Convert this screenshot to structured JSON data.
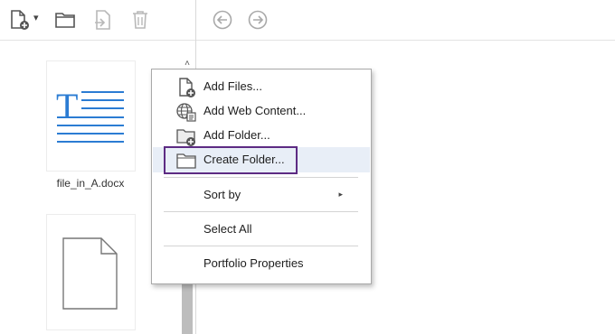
{
  "toolbar": {
    "icons": [
      "new-file-icon",
      "folder-icon",
      "extract-icon",
      "trash-icon",
      "back-icon",
      "forward-icon"
    ],
    "dropdown_glyph": "▾"
  },
  "files": [
    {
      "name": "file_in_A.docx",
      "icon": "docx-icon"
    },
    {
      "name": "",
      "icon": "blank-file-icon"
    }
  ],
  "scrollbar": {
    "up_glyph": "˄"
  },
  "context_menu": {
    "items": [
      {
        "label": "Add Files...",
        "icon": "add-file-icon"
      },
      {
        "label": "Add Web Content...",
        "icon": "web-content-icon"
      },
      {
        "label": "Add Folder...",
        "icon": "add-folder-icon"
      },
      {
        "label": "Create Folder...",
        "icon": "create-folder-icon",
        "highlighted": true
      },
      {
        "label": "Sort by",
        "has_submenu": true,
        "submenu_glyph": "▸"
      },
      {
        "label": "Select All"
      },
      {
        "label": "Portfolio Properties"
      }
    ]
  },
  "colors": {
    "focus_outline": "#5d2b83",
    "highlight": "#e8eef7",
    "docx_blue": "#2b7cd3"
  }
}
